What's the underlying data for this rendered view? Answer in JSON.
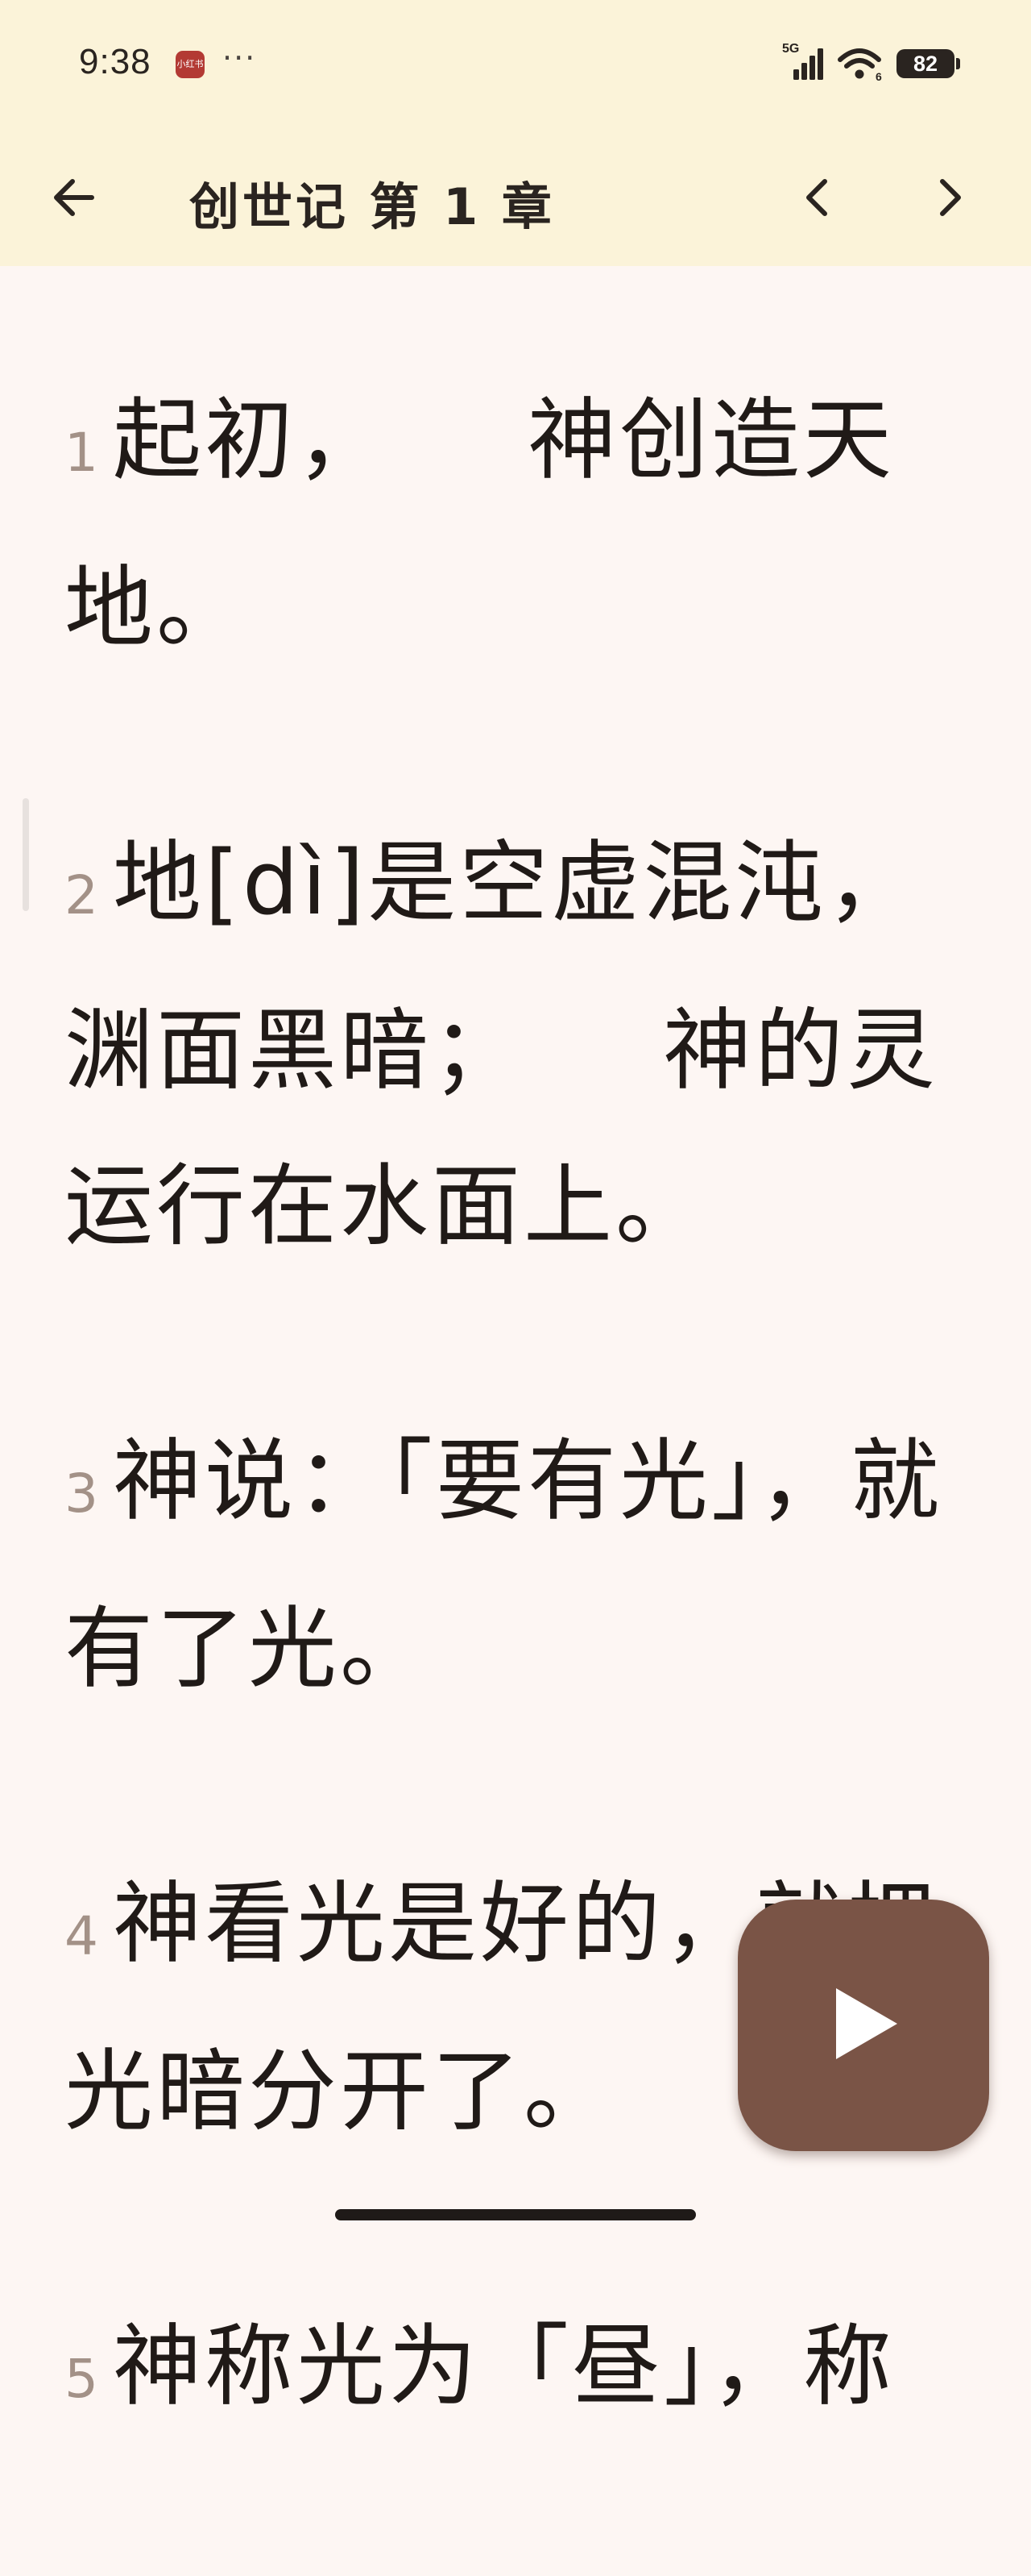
{
  "status_bar": {
    "time": "9:38",
    "app_icon_label": "小红书",
    "more": "···",
    "network": "5G",
    "wifi_label": "6",
    "battery": "82"
  },
  "header": {
    "title": "创世记 第 1 章",
    "back_icon": "arrow-left-icon",
    "prev_icon": "chevron-left-icon",
    "next_icon": "chevron-right-icon"
  },
  "verses": [
    {
      "num": "1",
      "text": "起初，　　神创造天地。"
    },
    {
      "num": "2",
      "text": "地[dì]是空虚混沌，渊面黑暗；　　神的灵运行在水面上。"
    },
    {
      "num": "3",
      "text": "神说：「要有光」，就有了光。"
    },
    {
      "num": "4",
      "text": "神看光是好的，就把光暗分开了。"
    },
    {
      "num": "5",
      "text": "神称光为「昼」，称"
    }
  ],
  "player": {
    "icon": "play-icon"
  },
  "colors": {
    "header_bg": "#fbf3d9",
    "page_bg": "#fdf6f3",
    "fab_bg": "#7a5446",
    "verse_number": "#a39187"
  }
}
